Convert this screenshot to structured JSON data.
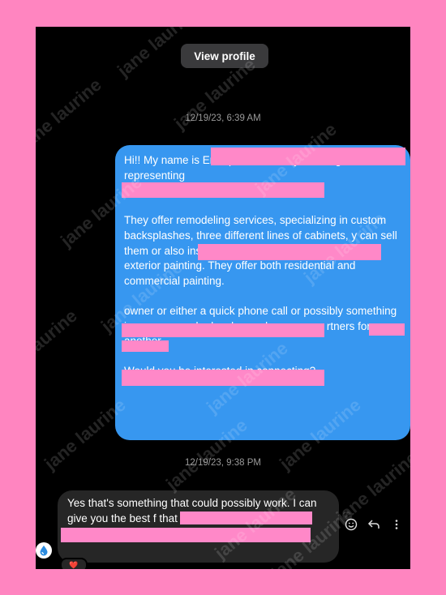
{
  "header": {
    "view_profile_label": "View profile"
  },
  "timestamps": [
    "12/19/23, 6:39 AM",
    "12/19/23, 9:38 PM"
  ],
  "sent_message": {
    "paragraphs": [
      "Hi!! My name is                                                   Enterprises recently has begun representing",
      "They offer remodeling services, specializing in custom backsplashes, three different lines of cabinets,                                                                 y can sell them or also install them), and also both interior and exterior painting. They offer both residential and commercial painting.",
      "                                                              owner                      or either a quick phone call or possibly something in person, maybe lunch one day soon, as                                                       rtners for one another.",
      "Would you be interested in connecting?"
    ]
  },
  "received_message": {
    "text": "Yes that's something that could possibly work. I can give you the best                                                                                                                  f that works for you.",
    "reaction": "❤️"
  },
  "actions": [
    "emoji-icon",
    "reply-icon",
    "more-icon"
  ],
  "watermark": "jane laurine",
  "colors": {
    "sent_bubble": "#3797f0",
    "received_bubble": "#262626",
    "redaction": "#ff88c8",
    "background": "#ff85c0"
  }
}
